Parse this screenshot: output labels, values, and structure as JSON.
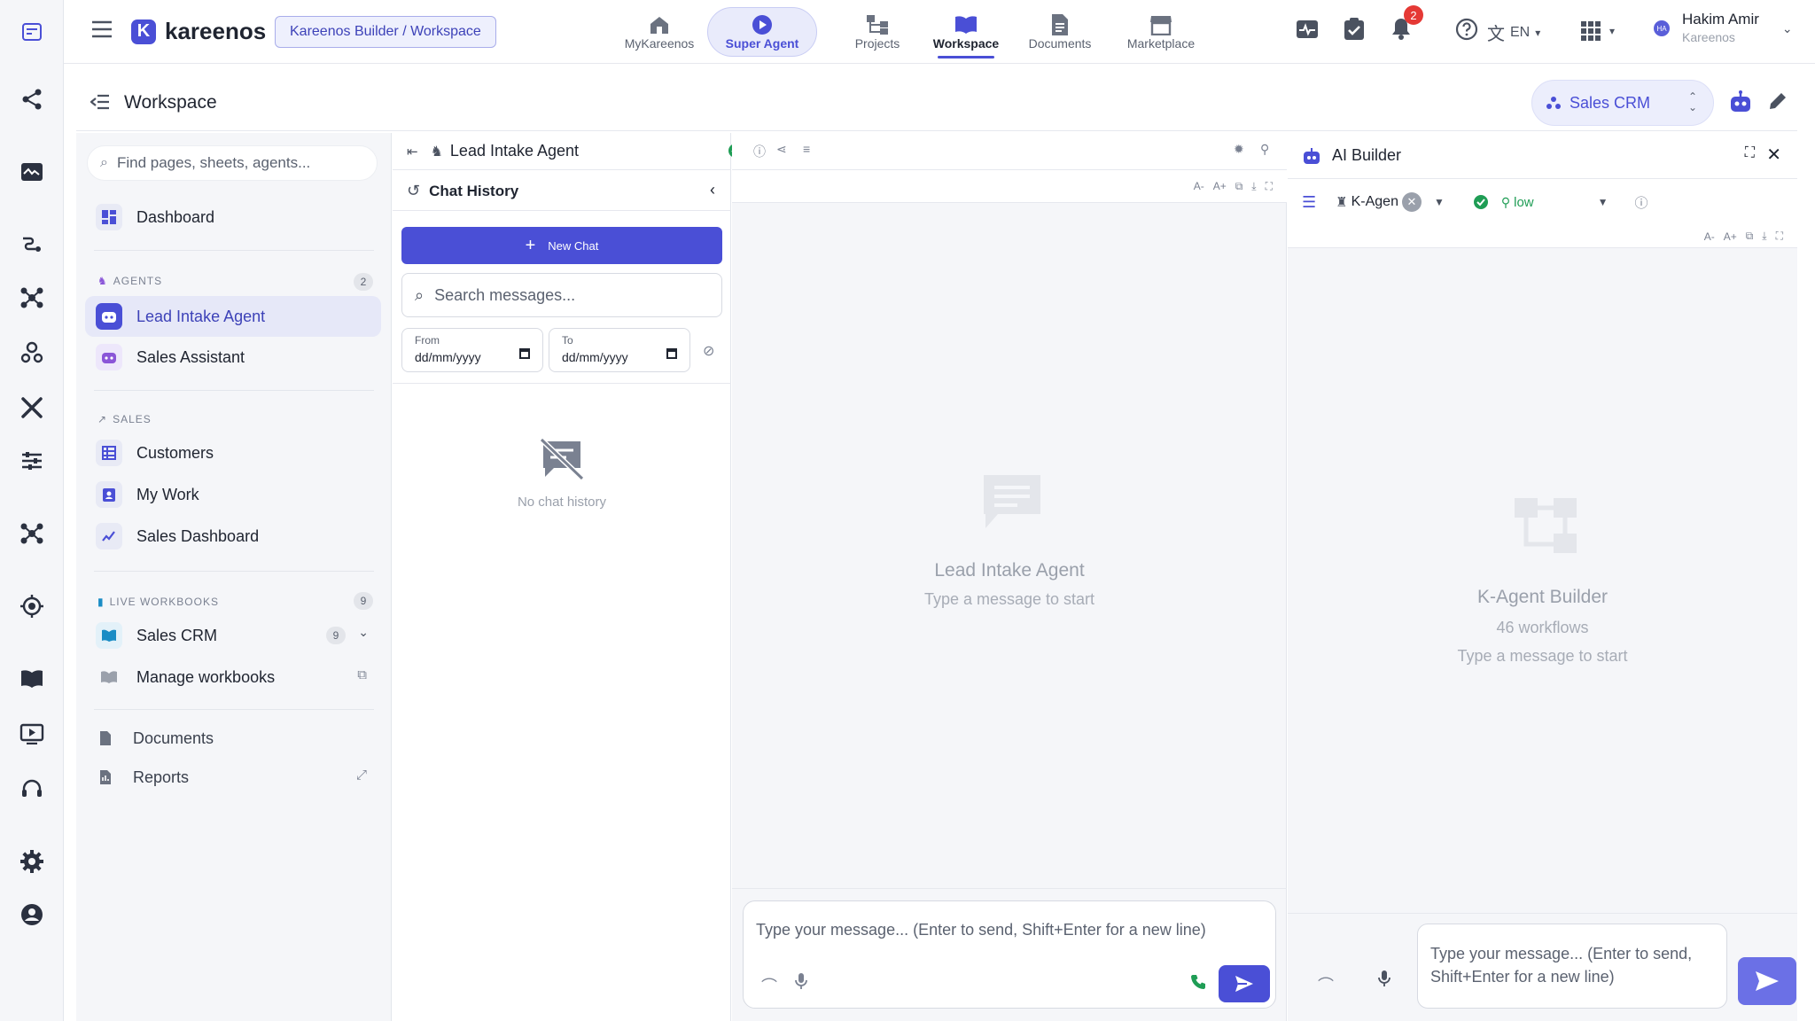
{
  "app": {
    "name": "kareenos",
    "breadcrumb": "Kareenos Builder / Workspace"
  },
  "nav": {
    "items": [
      {
        "label": "MyKareenos",
        "icon": "home-icon"
      },
      {
        "label": "Super Agent",
        "icon": "play-icon"
      },
      {
        "label": "Projects",
        "icon": "projects-icon"
      },
      {
        "label": "Workspace",
        "icon": "workspace-icon"
      },
      {
        "label": "Documents",
        "icon": "document-icon"
      },
      {
        "label": "Marketplace",
        "icon": "store-icon"
      }
    ],
    "active": "Workspace"
  },
  "header_right": {
    "notifications_count": "2",
    "language": "EN",
    "user_name": "Hakim Amir",
    "user_org": "Kareenos",
    "avatar_initials": "HA"
  },
  "page": {
    "title": "Workspace",
    "workbook_selector": "Sales CRM"
  },
  "sidebar": {
    "search_placeholder": "Find pages, sheets, agents...",
    "dashboard": "Dashboard",
    "agents_section": "AGENTS",
    "agents_count": "2",
    "agents": [
      "Lead Intake Agent",
      "Sales Assistant"
    ],
    "sales_section": "SALES",
    "sales_items": [
      "Customers",
      "My Work",
      "Sales Dashboard"
    ],
    "workbooks_section": "LIVE WORKBOOKS",
    "workbooks_count": "9",
    "workbook": "Sales CRM",
    "workbook_count": "9",
    "manage_workbooks": "Manage workbooks",
    "documents": "Documents",
    "reports": "Reports"
  },
  "agent_panel": {
    "title": "Lead Intake Agent",
    "history_title": "Chat History",
    "new_chat": "New Chat",
    "search_placeholder": "Search messages...",
    "from_label": "From",
    "to_label": "To",
    "date_placeholder": "dd/mm/yyyy",
    "empty_history": "No chat history"
  },
  "chat": {
    "font_decrease": "A-",
    "font_increase": "A+",
    "empty_title": "Lead Intake Agent",
    "empty_subtitle": "Type a message to start",
    "input_placeholder": "Type your message...  (Enter to send, Shift+Enter for a new line)"
  },
  "builder": {
    "title": "AI Builder",
    "agent_chip": "K-Agen",
    "level": "low",
    "empty_title": "K-Agent Builder",
    "workflows": "46 workflows",
    "empty_subtitle": "Type a message to start",
    "input_placeholder": "Type your message...  (Enter to send, Shift+Enter for a new line)"
  },
  "colors": {
    "accent": "#4a4fd6",
    "success": "#1f9d55",
    "danger": "#e53935"
  }
}
